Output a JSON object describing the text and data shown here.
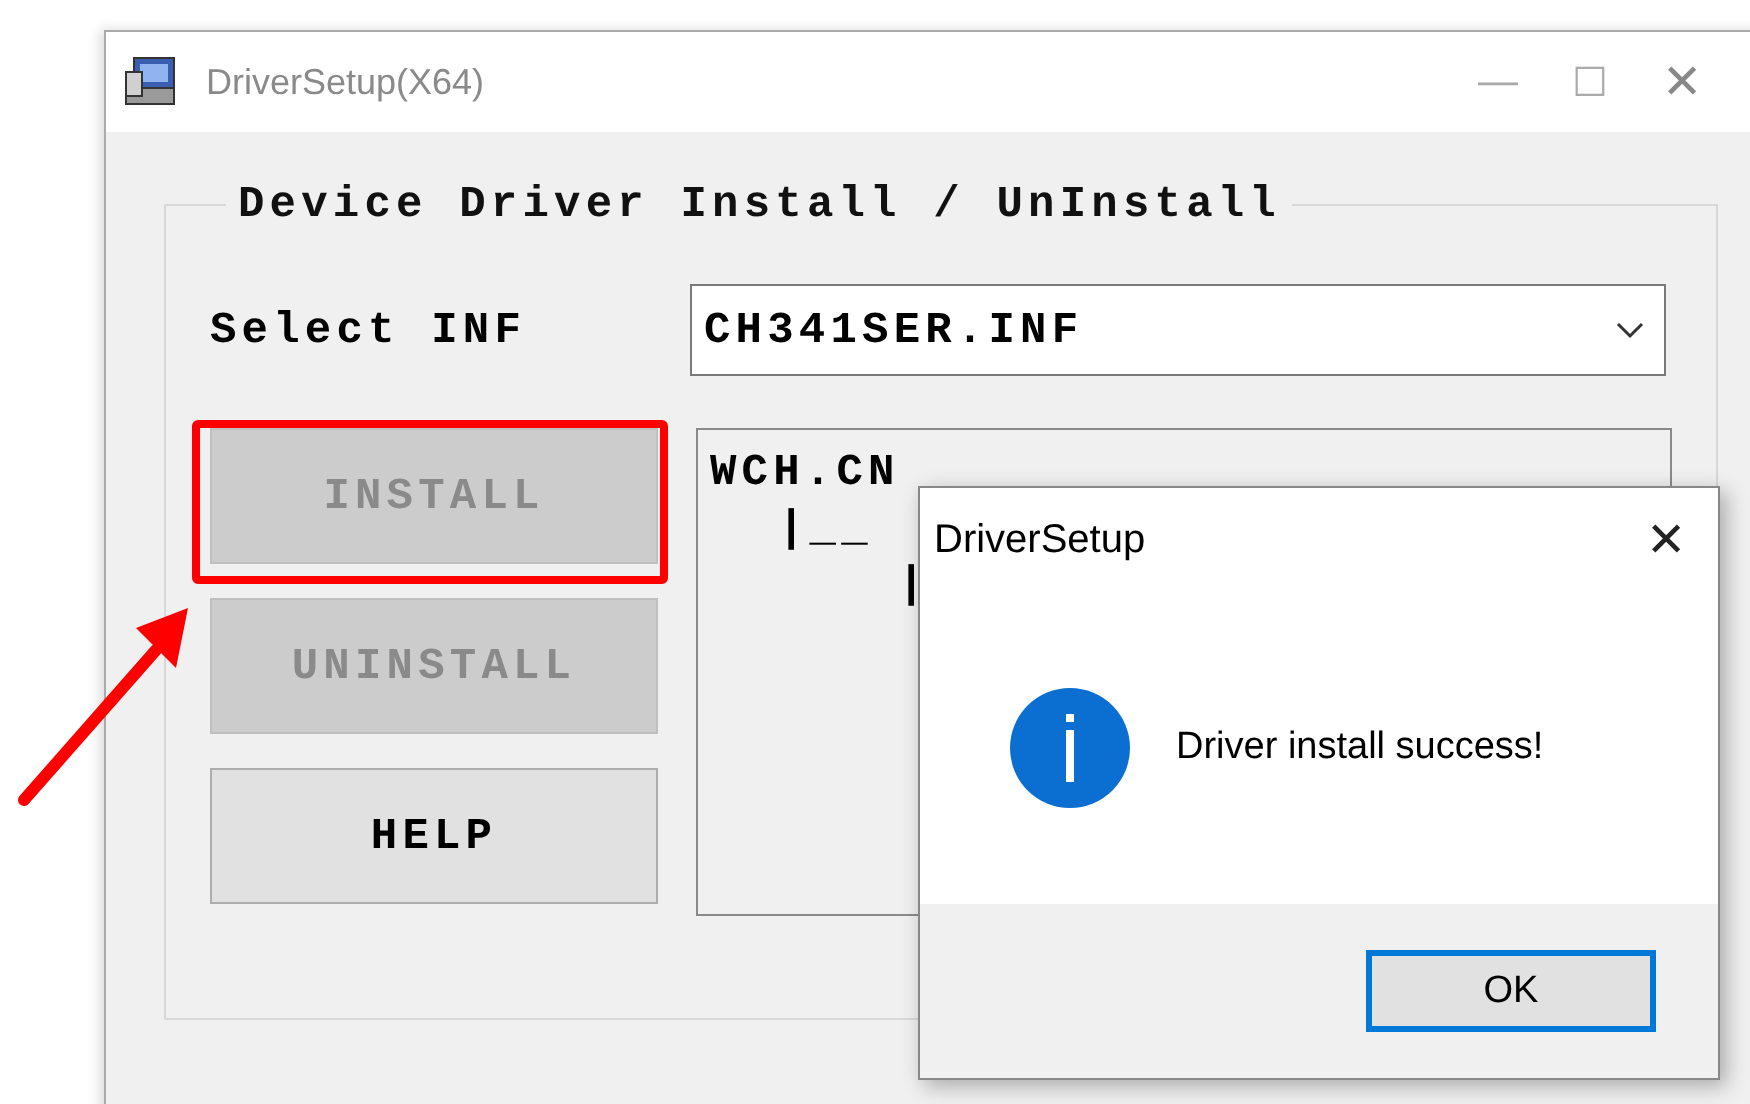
{
  "window": {
    "title": "DriverSetup(X64)",
    "controls": [
      "—",
      "☐",
      "✕"
    ]
  },
  "group": {
    "title": "Device Driver Install / UnInstall"
  },
  "select_inf": {
    "label": "Select INF",
    "value": "CH341SER.INF"
  },
  "buttons": [
    {
      "label": "INSTALL",
      "disabled": true,
      "highlighted": true
    },
    {
      "label": "UNINSTALL",
      "disabled": true,
      "highlighted": false
    },
    {
      "label": "HELP",
      "disabled": false,
      "highlighted": false
    }
  ],
  "tree": [
    {
      "label": "WCH.CN",
      "children": [
        {
          "label": "|__",
          "children": [
            {
              "label": "|"
            }
          ]
        }
      ]
    }
  ],
  "dialog": {
    "title": "DriverSetup",
    "close": "✕",
    "message": "Driver install success!",
    "button": "OK"
  }
}
